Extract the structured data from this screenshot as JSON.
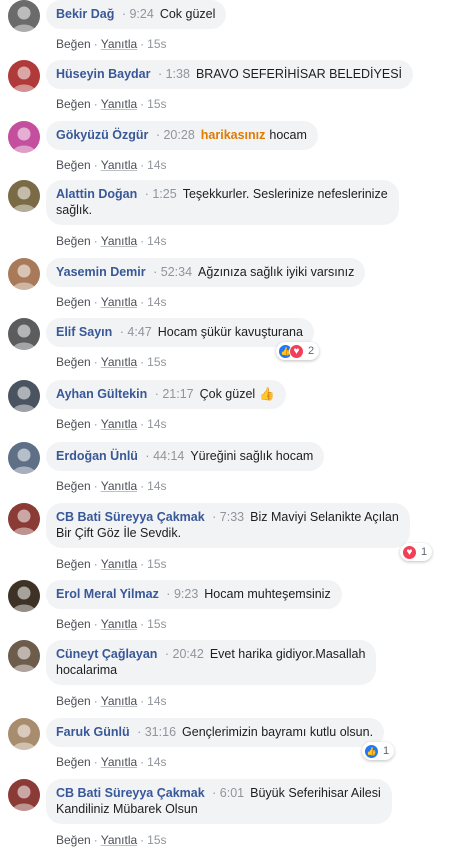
{
  "actions": {
    "like": "Beğen",
    "reply": "Yanıtla",
    "dot": "·"
  },
  "comments": [
    {
      "author": "Bekir Dağ",
      "time": "9:24",
      "text": "Cok güzel",
      "age": "15s",
      "avatar": "#6b6b6b"
    },
    {
      "author": "Hüseyin Baydar",
      "time": "1:38",
      "text": "BRAVO SEFERİHİSAR BELEDİYESİ",
      "age": "15s",
      "avatar": "#b03a3a"
    },
    {
      "author": "Gökyüzü Özgür",
      "time": "20:28",
      "tag": "harikasınız",
      "text": "hocam",
      "age": "14s",
      "avatar": "#c44f9e"
    },
    {
      "author": "Alattin Doğan",
      "time": "1:25",
      "text": "Teşekkurler. Seslerinize nefeslerinize",
      "text2": "sağlık.",
      "age": "14s",
      "avatar": "#7a6a46"
    },
    {
      "author": "Yasemin Demir",
      "time": "52:34",
      "text": "Ağzınıza sağlık iyiki varsınız",
      "age": "14s",
      "avatar": "#a87a5a"
    },
    {
      "author": "Elif Sayın",
      "time": "4:47",
      "text": "Hocam şükür kavuşturana",
      "age": "15s",
      "avatar": "#5a5c5e",
      "reaction": {
        "types": [
          "like",
          "love"
        ],
        "count": "2"
      }
    },
    {
      "author": "Ayhan Gültekin",
      "time": "21:17",
      "text": "Çok güzel",
      "emoji": "👍",
      "age": "14s",
      "avatar": "#4a5460"
    },
    {
      "author": "Erdoğan Ünlü",
      "time": "44:14",
      "text": "Yüreğini sağlık hocam",
      "age": "14s",
      "avatar": "#5e6f86"
    },
    {
      "author": "CB Bati Süreyya Çakmak",
      "time": "7:33",
      "text": "Biz Maviyi Selanikte Açılan",
      "text2": "Bir Çift Göz İle Sevdik.",
      "age": "15s",
      "avatar": "#8a3b36",
      "reaction": {
        "types": [
          "love"
        ],
        "count": "1"
      }
    },
    {
      "author": "Erol Meral Yilmaz",
      "time": "9:23",
      "text": "Hocam muhteşemsiniz",
      "age": "15s",
      "avatar": "#3e3226"
    },
    {
      "author": "Cüneyt Çağlayan",
      "time": "20:42",
      "text": "Evet harika gidiyor.Masallah",
      "text2": "hocalarima",
      "age": "14s",
      "avatar": "#6d5b4c"
    },
    {
      "author": "Faruk Günlü",
      "time": "31:16",
      "text": "Gençlerimizin bayramı kutlu olsun.",
      "age": "14s",
      "avatar": "#a88c6e",
      "reaction": {
        "types": [
          "like"
        ],
        "count": "1"
      }
    },
    {
      "author": "CB Bati Süreyya Çakmak",
      "time": "6:01",
      "text": "Büyük Seferihisar Ailesi",
      "text2": "Kandiliniz Mübarek Olsun",
      "age": "15s",
      "avatar": "#8a3b36"
    }
  ]
}
